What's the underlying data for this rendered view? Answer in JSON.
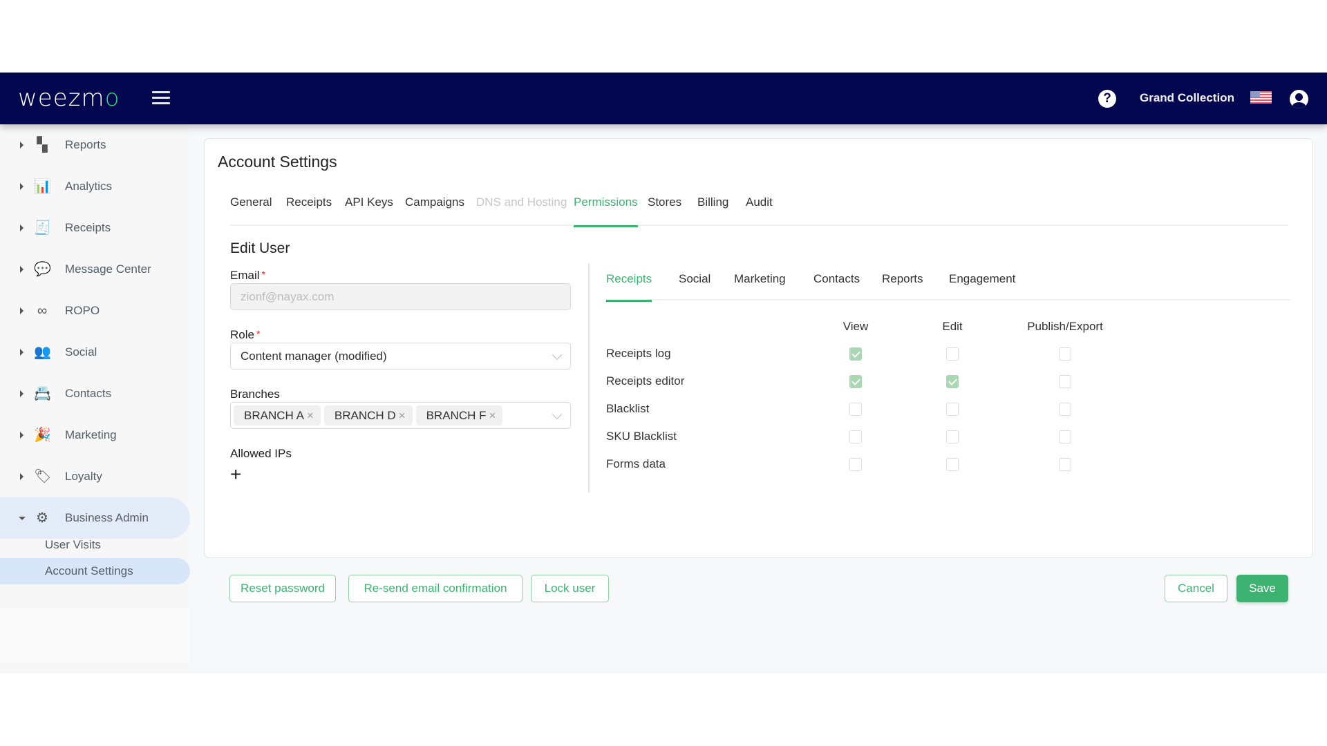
{
  "header": {
    "logo_main": "weezm",
    "logo_accent": "o",
    "account_name": "Grand Collection",
    "help_glyph": "?"
  },
  "sidebar": {
    "items": [
      {
        "label": "Reports",
        "icon": "dashboard-icon",
        "glyph": "▚"
      },
      {
        "label": "Analytics",
        "icon": "bar-chart-icon",
        "glyph": "📊"
      },
      {
        "label": "Receipts",
        "icon": "receipt-icon",
        "glyph": "🧾"
      },
      {
        "label": "Message Center",
        "icon": "chat-icon",
        "glyph": "💬"
      },
      {
        "label": "ROPO",
        "icon": "infinity-icon",
        "glyph": "∞"
      },
      {
        "label": "Social",
        "icon": "people-icon",
        "glyph": "👥"
      },
      {
        "label": "Contacts",
        "icon": "contacts-icon",
        "glyph": "📇"
      },
      {
        "label": "Marketing",
        "icon": "party-popper-icon",
        "glyph": "🎉"
      },
      {
        "label": "Loyalty",
        "icon": "tag-heart-icon",
        "glyph": "🏷"
      },
      {
        "label": "Business Admin",
        "icon": "gear-icon",
        "glyph": "⚙",
        "expanded": true
      }
    ],
    "sub_items": [
      {
        "label": "User Visits",
        "active": false
      },
      {
        "label": "Account Settings",
        "active": true
      }
    ]
  },
  "page": {
    "title": "Account Settings",
    "tabs": [
      {
        "label": "General",
        "state": "normal"
      },
      {
        "label": "Receipts",
        "state": "normal"
      },
      {
        "label": "API Keys",
        "state": "normal"
      },
      {
        "label": "Campaigns",
        "state": "normal"
      },
      {
        "label": "DNS and Hosting",
        "state": "disabled"
      },
      {
        "label": "Permissions",
        "state": "active"
      },
      {
        "label": "Stores",
        "state": "normal"
      },
      {
        "label": "Billing",
        "state": "normal"
      },
      {
        "label": "Audit",
        "state": "normal"
      }
    ]
  },
  "edit_user": {
    "title": "Edit User",
    "email_label": "Email",
    "email_value": "zionf@nayax.com",
    "required_mark": "*",
    "role_label": "Role",
    "role_value": "Content manager (modified)",
    "branches_label": "Branches",
    "branches": [
      "BRANCH A",
      "BRANCH D",
      "BRANCH F"
    ],
    "tag_remove_glyph": "×",
    "allowed_ips_label": "Allowed IPs",
    "add_glyph": "+"
  },
  "permissions": {
    "tabs": [
      {
        "label": "Receipts",
        "active": true
      },
      {
        "label": "Social",
        "active": false
      },
      {
        "label": "Marketing",
        "active": false
      },
      {
        "label": "Contacts",
        "active": false
      },
      {
        "label": "Reports",
        "active": false
      },
      {
        "label": "Engagement",
        "active": false
      }
    ],
    "columns": [
      "View",
      "Edit",
      "Publish/Export"
    ],
    "rows": [
      {
        "label": "Receipts log",
        "values": [
          true,
          false,
          false
        ]
      },
      {
        "label": "Receipts editor",
        "values": [
          true,
          true,
          false
        ]
      },
      {
        "label": "Blacklist",
        "values": [
          false,
          false,
          false
        ]
      },
      {
        "label": "SKU Blacklist",
        "values": [
          false,
          false,
          false
        ]
      },
      {
        "label": "Forms data",
        "values": [
          false,
          false,
          false
        ]
      }
    ]
  },
  "actions": {
    "reset_password": "Reset password",
    "resend_email": "Re-send email confirmation",
    "lock_user": "Lock user",
    "cancel": "Cancel",
    "save": "Save"
  },
  "colors": {
    "header_bg": "#03074f",
    "accent_green": "#3cb371",
    "logo_accent": "#2bd17e",
    "sidebar_active": "#d7e6f8"
  }
}
